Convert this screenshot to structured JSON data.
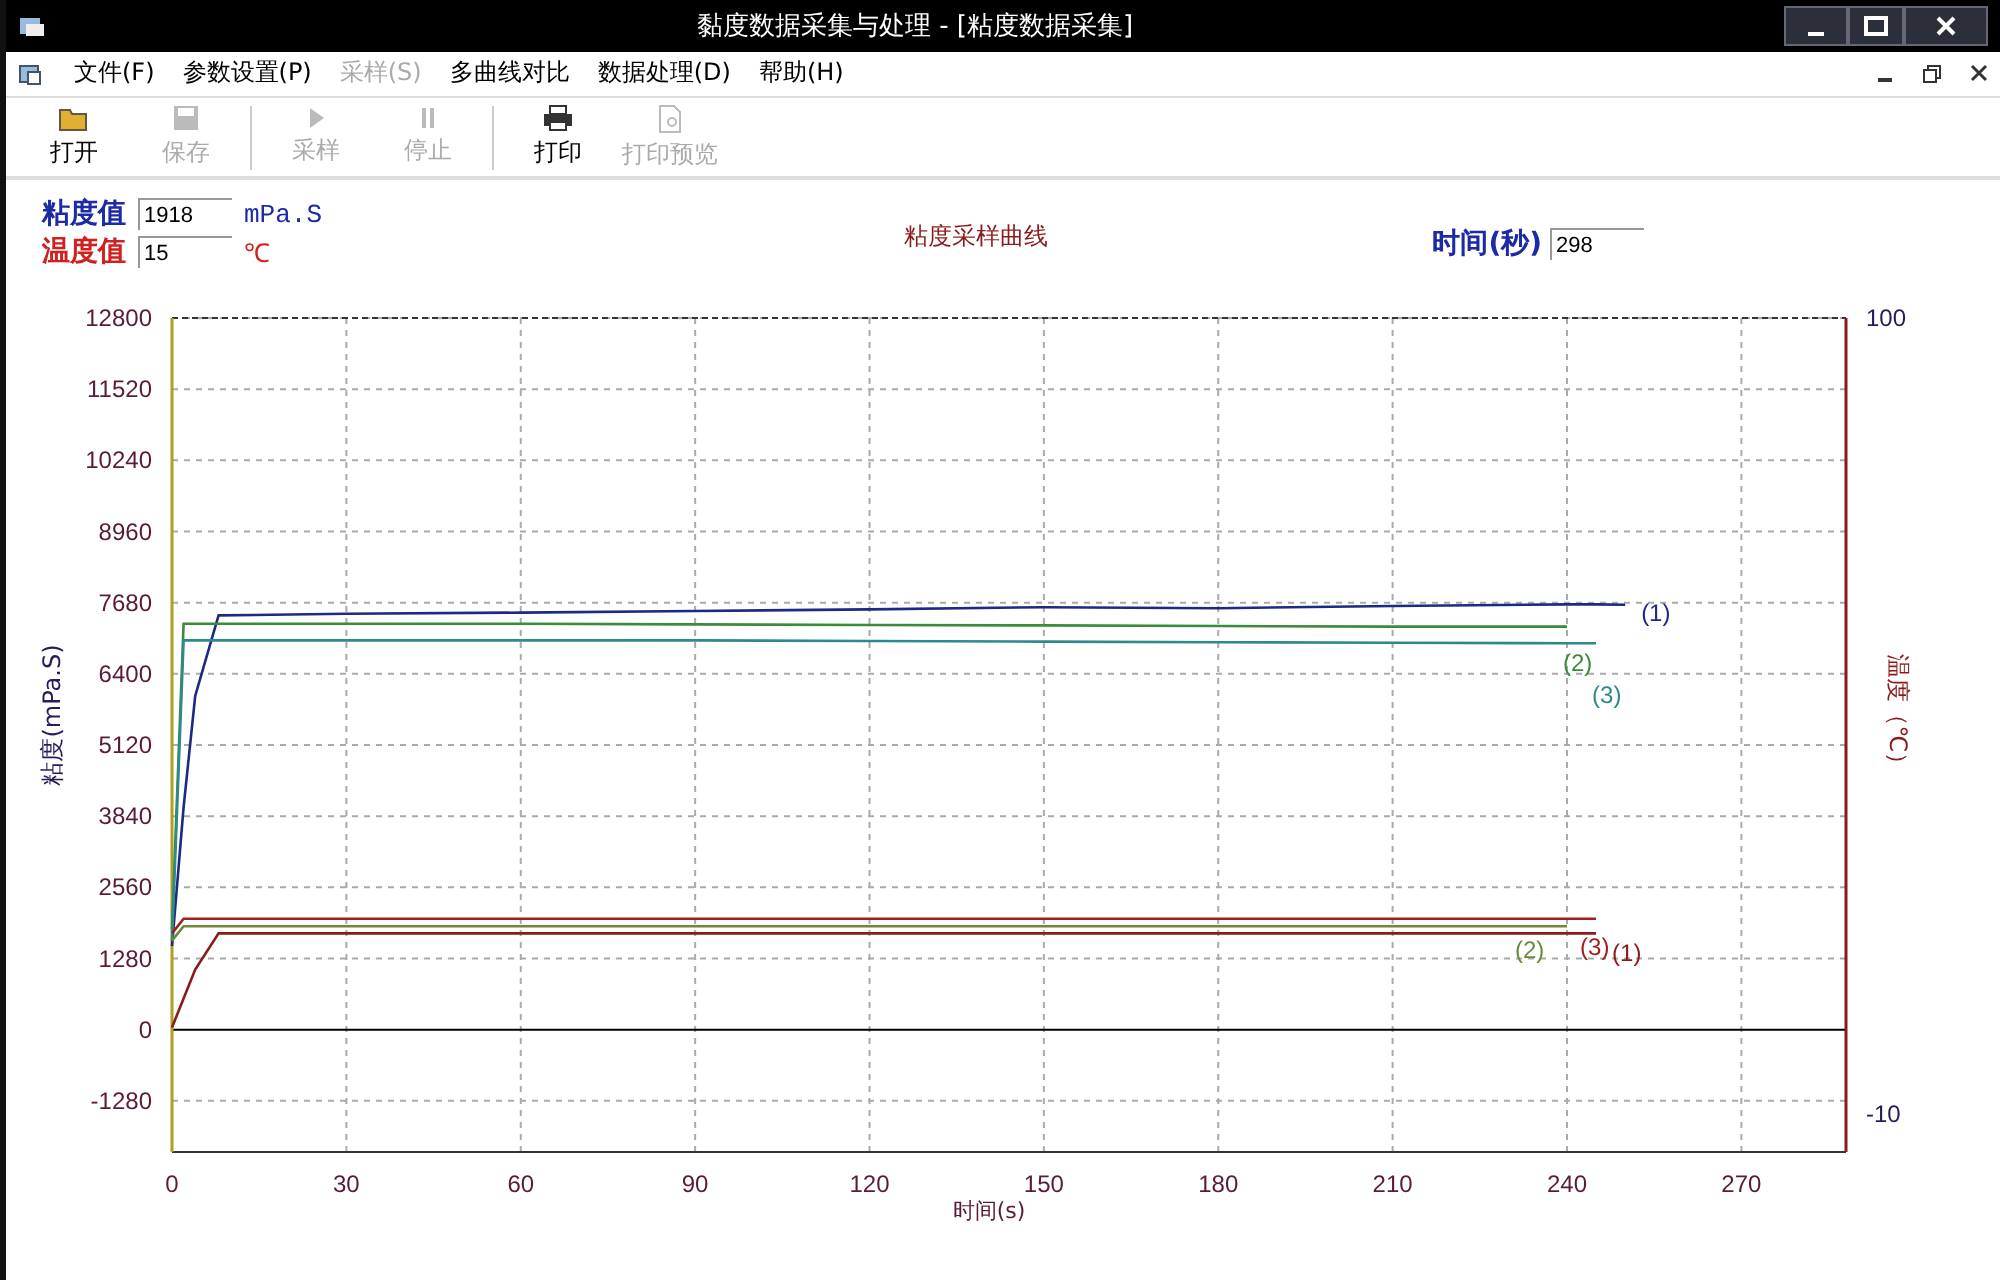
{
  "window": {
    "title": "黏度数据采集与处理 - [粘度数据采集]"
  },
  "menu": [
    {
      "label": "文件(F)",
      "disabled": false
    },
    {
      "label": "参数设置(P)",
      "disabled": false
    },
    {
      "label": "采样(S)",
      "disabled": true
    },
    {
      "label": "多曲线对比",
      "disabled": false
    },
    {
      "label": "数据处理(D)",
      "disabled": false
    },
    {
      "label": "帮助(H)",
      "disabled": false
    }
  ],
  "toolbar": [
    {
      "kind": "open",
      "label": "打开",
      "disabled": false
    },
    {
      "kind": "save",
      "label": "保存",
      "disabled": true
    },
    {
      "kind": "play",
      "label": "采样",
      "disabled": true
    },
    {
      "kind": "pause",
      "label": "停止",
      "disabled": true
    },
    {
      "kind": "print",
      "label": "打印",
      "disabled": false
    },
    {
      "kind": "preview",
      "label": "打印预览",
      "disabled": true
    }
  ],
  "readings": {
    "viscosity": {
      "label": "粘度值",
      "value": "1918",
      "unit": "mPa.S"
    },
    "temperature": {
      "label": "温度值",
      "value": "15",
      "unit": "℃"
    },
    "time": {
      "label": "时间(秒)",
      "value": "298"
    }
  },
  "chart": {
    "chart_data": {
      "type": "line",
      "title": "粘度采样曲线",
      "xlabel": "时间(s)",
      "ylabel": "粘度(mPa.S)",
      "y2label": "温度（℃）",
      "x": [
        0,
        2,
        4,
        8,
        30,
        60,
        90,
        120,
        150,
        180,
        210,
        240,
        245,
        250
      ],
      "xlim": [
        0,
        288
      ],
      "ylim": [
        -2200,
        12800
      ],
      "y2lim": [
        -15.2,
        100
      ],
      "xticks": [
        0,
        30,
        60,
        90,
        120,
        150,
        180,
        210,
        240,
        270
      ],
      "yticks": [
        -1280,
        0,
        1280,
        2560,
        3840,
        5120,
        6400,
        7680,
        8960,
        10240,
        11520,
        12800
      ],
      "y2ticks": [
        -10,
        100
      ],
      "series": [
        {
          "name": "(1)",
          "color": "#1c2a86",
          "values": [
            1500,
            4000,
            6000,
            7450,
            7480,
            7500,
            7530,
            7560,
            7600,
            7580,
            7620,
            7650,
            7650,
            7640
          ]
        },
        {
          "name": "(2)",
          "color": "#3a8c3a",
          "values": [
            1800,
            7300,
            7300,
            7300,
            7300,
            7300,
            7290,
            7280,
            7270,
            7260,
            7250,
            7250,
            null,
            null
          ]
        },
        {
          "name": "(3)",
          "color": "#2e8a8a",
          "values": [
            1600,
            7000,
            7000,
            7000,
            7000,
            7000,
            7000,
            6990,
            6980,
            6970,
            6960,
            6950,
            6950,
            null
          ]
        },
        {
          "name": "(1)",
          "axis": "y2",
          "color": "#8b1a1a",
          "values": [
            2,
            6,
            10,
            15,
            15,
            15,
            15,
            15,
            15,
            15,
            15,
            15,
            15,
            null
          ]
        },
        {
          "name": "(2)",
          "axis": "y2",
          "color": "#6a8c3a",
          "values": [
            14,
            16,
            16,
            16,
            16,
            16,
            16,
            16,
            16,
            16,
            16,
            16,
            null,
            null
          ]
        },
        {
          "name": "(3)",
          "axis": "y2",
          "color": "#a02020",
          "values": [
            15,
            17,
            17,
            17,
            17,
            17,
            17,
            17,
            17,
            17,
            17,
            17,
            17,
            null
          ]
        }
      ],
      "grid": true
    }
  }
}
